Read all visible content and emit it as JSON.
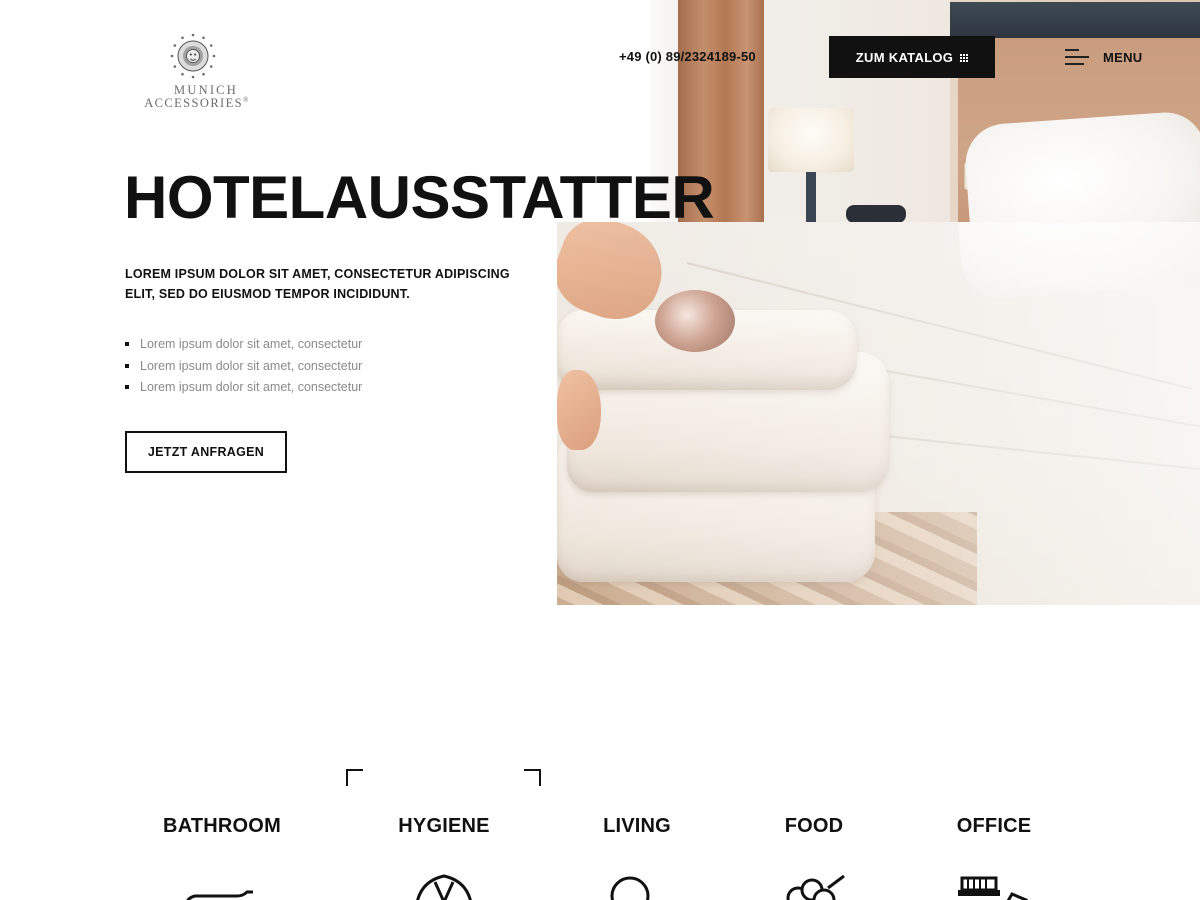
{
  "header": {
    "logo": {
      "line1": "MUNICH",
      "line2": "ACCESSORIES",
      "registered": "®"
    },
    "phone": "+49 (0) 89/2324189-50",
    "catalog_label": "ZUM KATALOG",
    "menu_label": "MENU"
  },
  "hero": {
    "title": "HOTELAUSSTATTER",
    "lead": "LOREM IPSUM DOLOR SIT AMET, CONSECTETUR ADIPISCING ELIT, SED DO EIUSMOD TEMPOR INCIDIDUNT.",
    "bullets": [
      "Lorem ipsum dolor sit amet, consectetur",
      "Lorem ipsum dolor sit amet, consectetur",
      "Lorem ipsum dolor sit amet, consectetur"
    ],
    "cta_label": "JETZT ANFRAGEN"
  },
  "categories": {
    "active": "HYGIENE",
    "items": [
      {
        "label": "BATHROOM",
        "icon": "bathtub-icon"
      },
      {
        "label": "HYGIENE",
        "icon": "bathrobe-icon"
      },
      {
        "label": "LIVING",
        "icon": "lamp-icon"
      },
      {
        "label": "FOOD",
        "icon": "ice-cream-icon"
      },
      {
        "label": "OFFICE",
        "icon": "stapler-icon"
      }
    ]
  },
  "icons": {
    "catalog_button": "grid-icon",
    "menu_button": "hamburger-menu-icon",
    "logo": "lion-seal-icon"
  },
  "colors": {
    "text": "#111111",
    "button_bg": "#111111",
    "button_text": "#ffffff",
    "muted_text": "#8a8a8a",
    "background": "#ffffff"
  }
}
